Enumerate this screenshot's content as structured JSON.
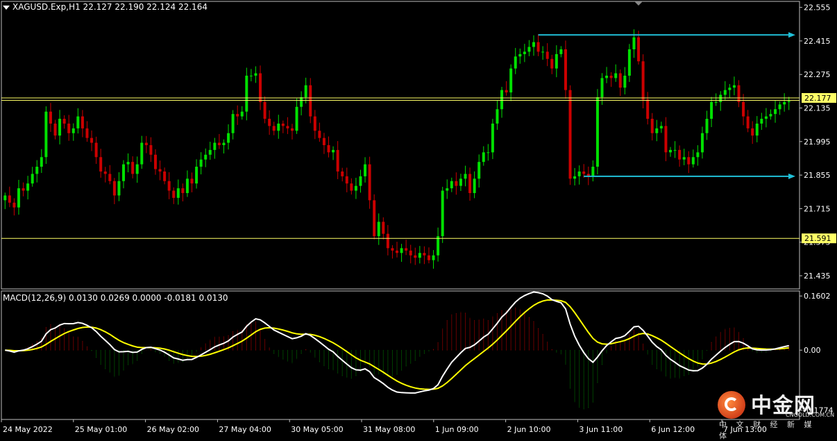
{
  "header": {
    "symbol_line": "XAGUSD.Exp,H1  22.127 22.190 22.124 22.164",
    "macd_line": "MACD(12,26,9) 0.0130 0.0269 0.0000 -0.0181 0.0130"
  },
  "colors": {
    "background": "#000000",
    "bull_candle": "#00e000",
    "bear_candle": "#cc0000",
    "level_line": "#ffff66",
    "trend_arrow": "#20c0d8",
    "macd_line": "#ffffff",
    "signal_line": "#ffff00",
    "hist_pos": "#cc0000",
    "hist_neg": "#008000",
    "grid_border": "#c0c0c0"
  },
  "brand": {
    "name": "中金网",
    "url": "CNGOLD.COM.CN",
    "tagline": "中 文 财 经 新 媒 体",
    "logo_icon": "cngold-disc-icon"
  },
  "chart_data": [
    {
      "type": "candlestick",
      "symbol": "XAGUSD.Exp",
      "timeframe": "H1",
      "ohlc_current": {
        "open": 22.127,
        "high": 22.19,
        "low": 22.124,
        "close": 22.164
      },
      "ylim": [
        21.38,
        22.58
      ],
      "y_ticks": [
        {
          "value": 22.555,
          "label": "22.555"
        },
        {
          "value": 22.415,
          "label": "22.415"
        },
        {
          "value": 22.275,
          "label": "22.275"
        },
        {
          "value": 22.135,
          "label": "22.135"
        },
        {
          "value": 21.995,
          "label": "21.995"
        },
        {
          "value": 21.855,
          "label": "21.855"
        },
        {
          "value": 21.715,
          "label": "21.715"
        },
        {
          "value": 21.575,
          "label": "21.575"
        },
        {
          "value": 21.435,
          "label": "21.435"
        }
      ],
      "x_labels": [
        "24 May 2022",
        "25 May 01:00",
        "26 May 02:00",
        "27 May 04:00",
        "30 May 05:00",
        "31 May 08:00",
        "1 Jun 09:00",
        "2 Jun 10:00",
        "3 Jun 11:00",
        "6 Jun 12:00",
        "7 Jun 13:00"
      ],
      "bar_count": 173,
      "levels": [
        {
          "price": 22.177,
          "label": "22.177"
        },
        {
          "price": 21.591,
          "label": "21.591"
        }
      ],
      "second_line_price": 22.167,
      "trend_arrows": [
        {
          "from_bar": 117,
          "from_price": 22.44,
          "to_bar": 193,
          "to_price": 22.44
        },
        {
          "from_bar": 127,
          "from_price": 21.85,
          "to_bar": 193,
          "to_price": 21.85
        }
      ],
      "closes": [
        21.77,
        21.74,
        21.72,
        21.8,
        21.79,
        21.82,
        21.86,
        21.89,
        21.93,
        22.12,
        22.07,
        22.02,
        22.09,
        22.07,
        22.03,
        22.05,
        22.1,
        22.05,
        22.01,
        21.99,
        21.93,
        21.87,
        21.86,
        21.83,
        21.77,
        21.83,
        21.9,
        21.91,
        21.86,
        21.9,
        21.99,
        21.98,
        21.94,
        21.88,
        21.87,
        21.83,
        21.79,
        21.76,
        21.8,
        21.78,
        21.84,
        21.82,
        21.89,
        21.92,
        21.94,
        21.96,
        21.99,
        21.98,
        21.99,
        22.03,
        22.11,
        22.1,
        22.12,
        22.27,
        22.27,
        22.28,
        22.16,
        22.09,
        22.06,
        22.04,
        22.07,
        22.06,
        22.05,
        22.04,
        22.14,
        22.18,
        22.23,
        22.1,
        22.04,
        22.01,
        21.98,
        21.95,
        21.96,
        21.87,
        21.85,
        21.82,
        21.79,
        21.81,
        21.85,
        21.9,
        21.75,
        21.6,
        21.66,
        21.61,
        21.55,
        21.54,
        21.53,
        21.55,
        21.54,
        21.52,
        21.51,
        21.53,
        21.52,
        21.5,
        21.52,
        21.6,
        21.79,
        21.8,
        21.83,
        21.81,
        21.84,
        21.86,
        21.78,
        21.84,
        21.91,
        21.95,
        21.95,
        22.07,
        22.13,
        22.21,
        22.2,
        22.3,
        22.35,
        22.36,
        22.37,
        22.39,
        22.41,
        22.37,
        22.37,
        22.34,
        22.3,
        22.36,
        22.38,
        22.21,
        21.84,
        21.85,
        21.87,
        21.86,
        21.85,
        21.89,
        22.18,
        22.26,
        22.27,
        22.26,
        22.28,
        22.22,
        22.27,
        22.38,
        22.43,
        22.33,
        22.17,
        22.09,
        22.03,
        22.05,
        22.06,
        21.95,
        21.96,
        21.96,
        21.92,
        21.93,
        21.9,
        21.93,
        21.95,
        22.03,
        22.09,
        22.16,
        22.16,
        22.19,
        22.21,
        22.22,
        22.23,
        22.16,
        22.1,
        22.05,
        22.02,
        22.07,
        22.09,
        22.1,
        22.11,
        22.13,
        22.15,
        22.16,
        22.164
      ],
      "ohlc_sample_note": "",
      "macd": {
        "params": [
          12,
          26,
          9
        ],
        "readout": [
          0.013,
          0.0269,
          0.0,
          -0.0181,
          0.013
        ],
        "ylim": [
          -0.205,
          0.175
        ],
        "y_ticks": [
          {
            "value": 0.1602,
            "label": "0.1602"
          },
          {
            "value": 0.0,
            "label": "0.00"
          },
          {
            "value": -0.1774,
            "label": "-0.1774"
          }
        ]
      }
    }
  ]
}
